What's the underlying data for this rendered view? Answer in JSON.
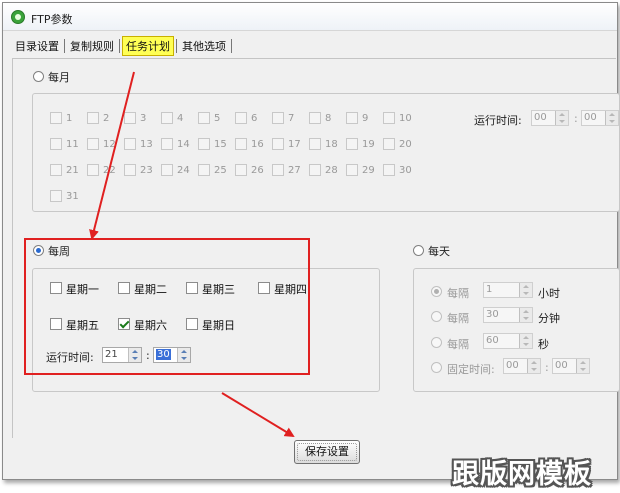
{
  "window": {
    "title": "FTP参数"
  },
  "tabs": [
    {
      "label": "目录设置"
    },
    {
      "label": "复制规则"
    },
    {
      "label": "任务计划"
    },
    {
      "label": "其他选项"
    }
  ],
  "monthly": {
    "label": "每月",
    "days": [
      "1",
      "2",
      "3",
      "4",
      "5",
      "6",
      "7",
      "8",
      "9",
      "10",
      "11",
      "12",
      "13",
      "14",
      "15",
      "16",
      "17",
      "18",
      "19",
      "20",
      "21",
      "22",
      "23",
      "24",
      "25",
      "26",
      "27",
      "28",
      "29",
      "30",
      "31"
    ],
    "run_time_label": "运行时间:",
    "hour": "00",
    "minute": "00",
    "colon": ":"
  },
  "weekly": {
    "label": "每周",
    "days": [
      "星期一",
      "星期二",
      "星期三",
      "星期四",
      "星期五",
      "星期六",
      "星期日"
    ],
    "run_time_label": "运行时间:",
    "hour": "21",
    "minute": "30",
    "colon": ":"
  },
  "daily": {
    "label": "每天",
    "every_label": "每隔",
    "hours_value": "1",
    "hours_unit": "小时",
    "minutes_value": "30",
    "minutes_unit": "分钟",
    "seconds_value": "60",
    "seconds_unit": "秒",
    "fixed_time_label": "固定时间:",
    "fixed_hour": "00",
    "fixed_minute": "00",
    "colon": ":"
  },
  "footer": {
    "save_label": "保存设置"
  },
  "watermark": "跟版网模板",
  "colors": {
    "highlight": "#ffff55",
    "annotation": "#e02020",
    "selection": "#3a6fd8"
  }
}
